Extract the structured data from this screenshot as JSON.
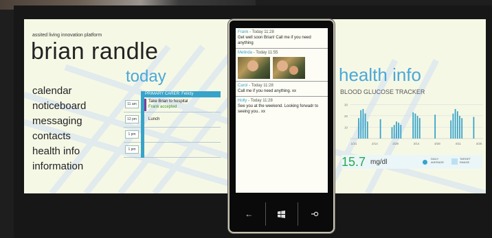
{
  "platform": "assited living innovation platform",
  "user_name": "brian randle",
  "nav": [
    "calendar",
    "noticeboard",
    "messaging",
    "contacts",
    "health info",
    "information"
  ],
  "today": {
    "heading": "today",
    "carer_bar": "PRIMARY CARER: Felicty",
    "slots": [
      {
        "time": "11 am",
        "lines": [
          "Take Brian to hospital",
          "Frank accepted"
        ]
      },
      {
        "time": "12 pm",
        "lines": [
          "Lunch"
        ]
      },
      {
        "time": "1 pm",
        "lines": []
      },
      {
        "time": "1 pm",
        "lines": []
      }
    ]
  },
  "phone": {
    "messages": [
      {
        "name": "Frank",
        "time": " - Today 11:28",
        "body": "Get well soon Brian! Call me if you need anything"
      },
      {
        "name": "Melinda",
        "time": " - Today 11:55",
        "body": ""
      },
      {
        "name": "Carol",
        "time": " - Today 11:28",
        "body": "Call me if you need anything. xx"
      },
      {
        "name": "Holly",
        "time": " - Today 11:28",
        "body": "See you at the weekend. Looking forwadr to seeing you.. xx"
      }
    ],
    "softkeys": [
      "back-icon",
      "windows-icon",
      "search-icon"
    ]
  },
  "health": {
    "heading": "health info",
    "tracker_title": "BLOOD GLUCOSE TRACKER",
    "reading_value": "15.7",
    "reading_unit": "mg/dl",
    "legend_daily": "DAILY AVERAGE",
    "legend_target": "TARGET RANGE"
  },
  "colors": {
    "accent": "#37a3c9",
    "heading": "#4aa8d8",
    "reading": "#2aa84a",
    "panel": "#f6f8e6"
  },
  "chart_data": {
    "type": "bar",
    "title": "BLOOD GLUCOSE TRACKER",
    "x_ticks": [
      "1/31",
      "2/14",
      "2/28",
      "3/14",
      "3/28",
      "4/11",
      "4/25"
    ],
    "y_ticks": [
      10,
      20,
      30
    ],
    "ylim": [
      0,
      35
    ],
    "bar_groups": [
      {
        "x": 0.1,
        "values": [
          18,
          25,
          26,
          22,
          15
        ]
      },
      {
        "x": 0.23,
        "values": [
          17
        ]
      },
      {
        "x": 0.35,
        "values": [
          10,
          12,
          15,
          14,
          12
        ]
      },
      {
        "x": 0.5,
        "values": [
          23,
          22,
          20,
          18
        ]
      },
      {
        "x": 0.64,
        "values": [
          21
        ]
      },
      {
        "x": 0.8,
        "values": [
          16,
          22,
          26,
          24,
          20,
          18
        ]
      },
      {
        "x": 0.93,
        "values": [
          19
        ]
      }
    ]
  }
}
